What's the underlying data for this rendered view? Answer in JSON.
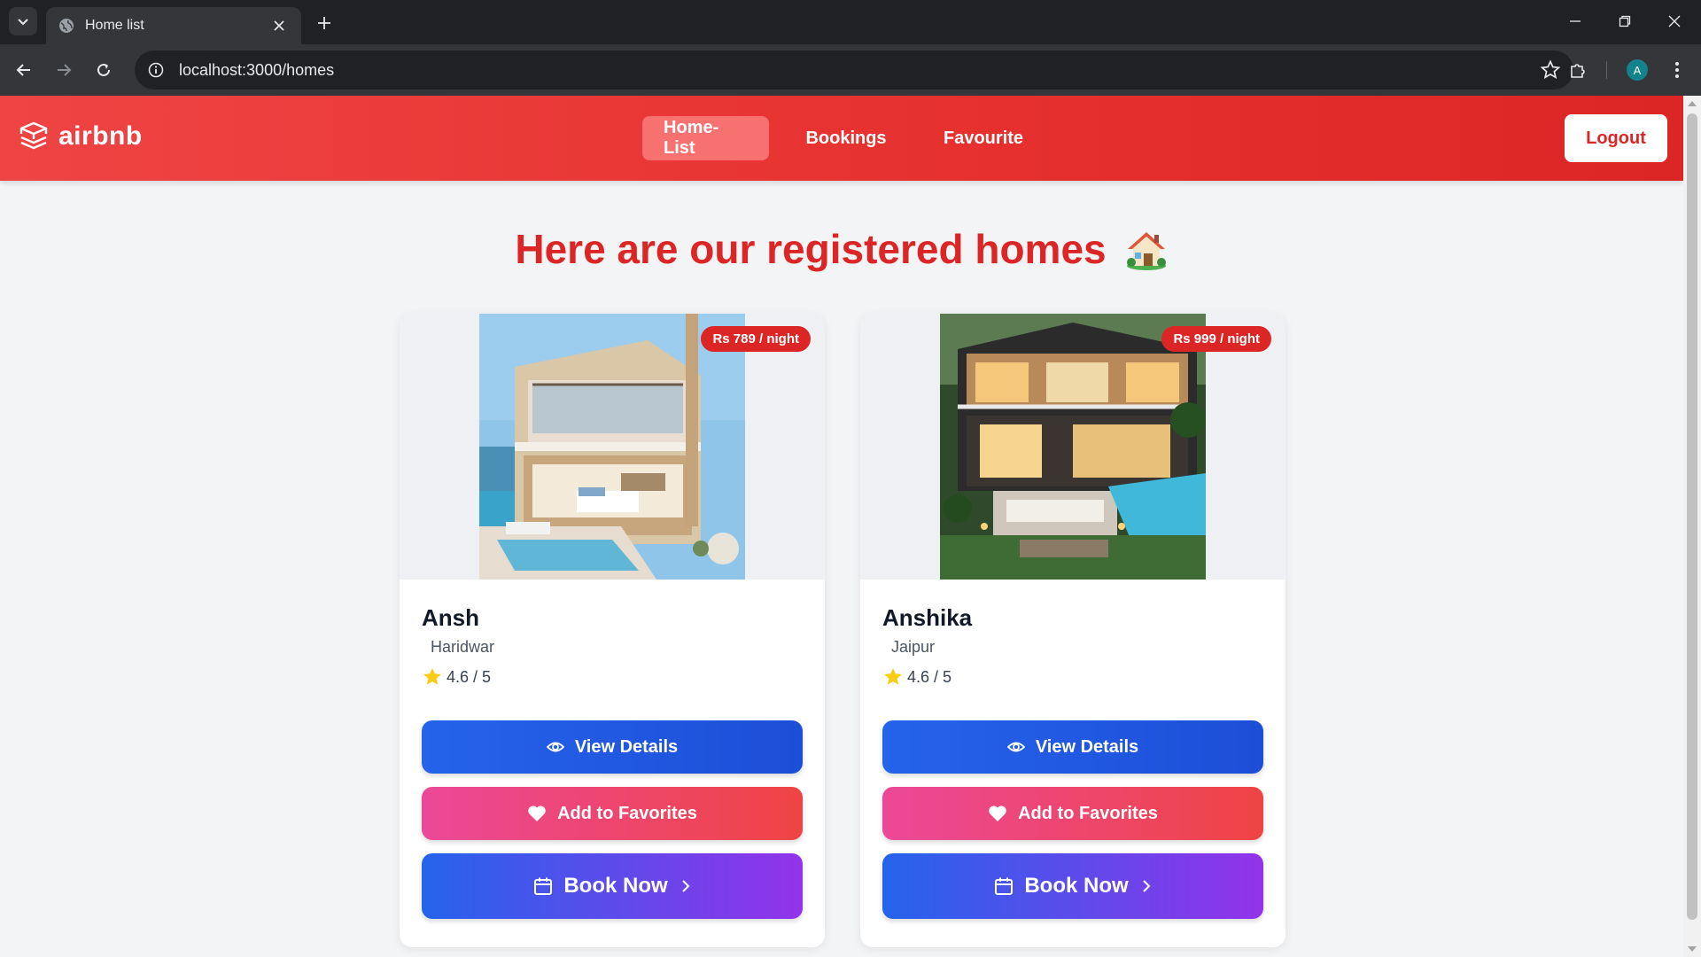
{
  "browser": {
    "tab_title": "Home list",
    "url": "localhost:3000/homes",
    "profile_initial": "A"
  },
  "navbar": {
    "brand": "airbnb",
    "links": [
      {
        "label": "Home-List",
        "active": true
      },
      {
        "label": "Bookings",
        "active": false
      },
      {
        "label": "Favourite",
        "active": false
      }
    ],
    "logout_label": "Logout"
  },
  "page": {
    "heading": "Here are our registered homes"
  },
  "homes": [
    {
      "name": "Ansh",
      "location": "Haridwar",
      "price": "Rs 789 / night",
      "rating": "4.6 / 5",
      "view_label": "View Details",
      "fav_label": "Add to Favorites",
      "book_label": "Book Now"
    },
    {
      "name": "Anshika",
      "location": "Jaipur",
      "price": "Rs 999 / night",
      "rating": "4.6 / 5",
      "view_label": "View Details",
      "fav_label": "Add to Favorites",
      "book_label": "Book Now"
    }
  ],
  "colors": {
    "brand_red": "#dc2626",
    "view_blue": "#2563eb",
    "favorite_pink": "#ec4899",
    "book_purple": "#9333ea"
  }
}
